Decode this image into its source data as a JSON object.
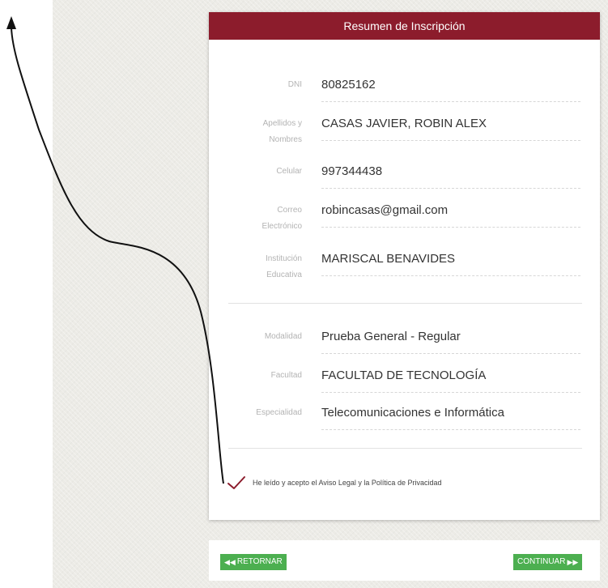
{
  "card": {
    "title": "Resumen de Inscripción",
    "fields": [
      {
        "label": "DNI",
        "value": "80825162"
      },
      {
        "label_line1": "Apellidos y",
        "label_line2": "Nombres",
        "value": "CASAS JAVIER, ROBIN ALEX"
      },
      {
        "label": "Celular",
        "value": "997344438"
      },
      {
        "label_line1": "Correo",
        "label_line2": "Electrónico",
        "value": "robincasas@gmail.com"
      },
      {
        "label_line1": "Institución",
        "label_line2": "Educativa",
        "value": "MARISCAL BENAVIDES"
      }
    ],
    "program": [
      {
        "label": "Modalidad",
        "value": "Prueba General - Regular"
      },
      {
        "label": "Facultad",
        "value": "FACULTAD DE TECNOLOGÍA"
      },
      {
        "label": "Especialidad",
        "value": "Telecomunicaciones e Informática"
      }
    ],
    "agreement": {
      "text": "He leído y acepto el Aviso Legal y la Política de Privacidad",
      "checked": true,
      "check_icon": "checkmark-icon"
    }
  },
  "navigation": {
    "back_label": "RETORNAR",
    "back_icon": "double-chevron-left-icon",
    "next_label": "CONTINUAR",
    "next_icon": "double-chevron-right-icon"
  },
  "colors": {
    "header": "#8c1c2c",
    "button": "#4caf50",
    "check": "#8c1c2c"
  }
}
